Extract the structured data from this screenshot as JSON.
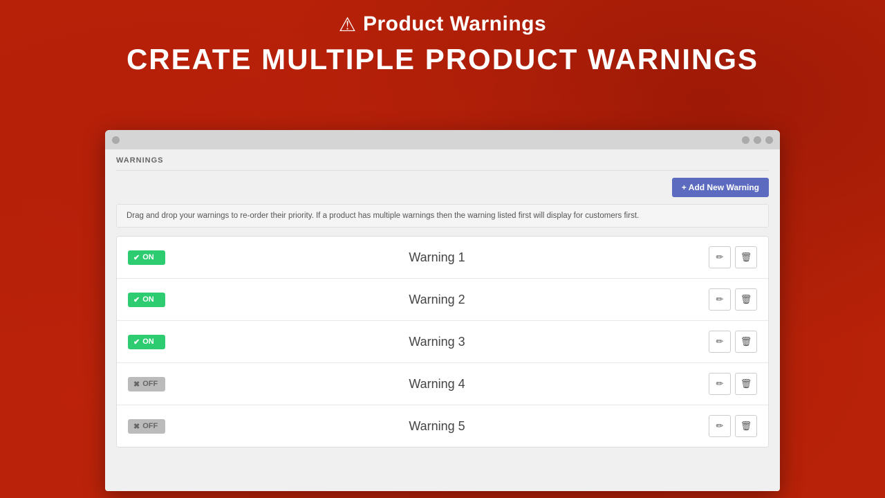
{
  "app": {
    "title": "Product Warnings",
    "icon": "⚠",
    "heading": "CREATE MULTIPLE PRODUCT WARNINGS"
  },
  "browser": {
    "dots_right": [
      "●",
      "●",
      "●"
    ]
  },
  "section": {
    "label": "WARNINGS",
    "add_button": "+ Add New Warning",
    "info_text": "Drag and drop your warnings to re-order their priority. If a product has multiple warnings then the warning listed first will display for customers first."
  },
  "warnings": [
    {
      "id": 1,
      "name": "Warning 1",
      "status": "ON",
      "status_type": "on"
    },
    {
      "id": 2,
      "name": "Warning 2",
      "status": "ON",
      "status_type": "on"
    },
    {
      "id": 3,
      "name": "Warning 3",
      "status": "ON",
      "status_type": "on"
    },
    {
      "id": 4,
      "name": "Warning 4",
      "status": "OFF",
      "status_type": "off"
    },
    {
      "id": 5,
      "name": "Warning 5",
      "status": "OFF",
      "status_type": "off"
    }
  ],
  "colors": {
    "on_badge": "#2ecc71",
    "off_badge": "#bbb",
    "add_button": "#5c6bc0"
  }
}
